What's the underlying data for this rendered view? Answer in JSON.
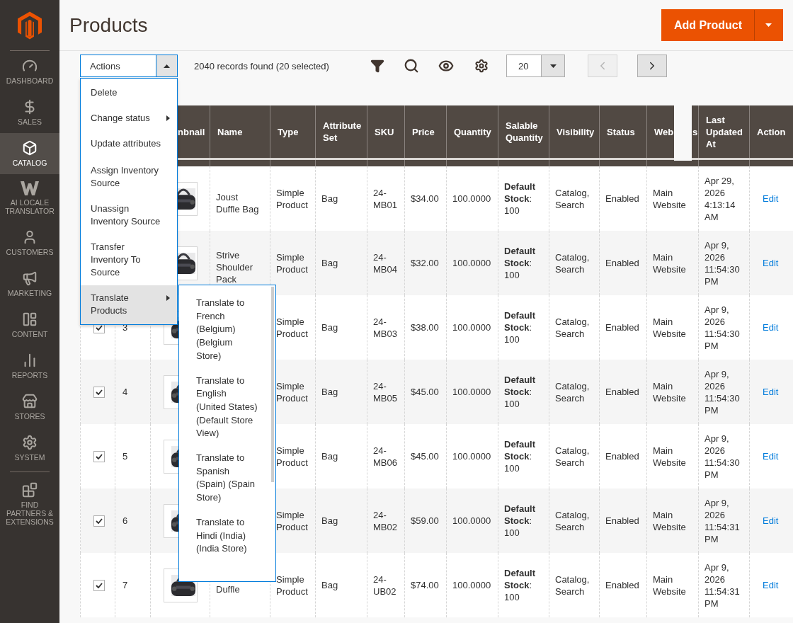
{
  "sidebar": {
    "items": [
      {
        "label": "DASHBOARD",
        "selected": false
      },
      {
        "label": "SALES",
        "selected": false
      },
      {
        "label": "CATALOG",
        "selected": true
      },
      {
        "label": "AI LOCALE TRANSLATOR",
        "selected": false
      },
      {
        "label": "CUSTOMERS",
        "selected": false
      },
      {
        "label": "MARKETING",
        "selected": false
      },
      {
        "label": "CONTENT",
        "selected": false
      },
      {
        "label": "REPORTS",
        "selected": false
      },
      {
        "label": "STORES",
        "selected": false
      },
      {
        "label": "SYSTEM",
        "selected": false
      },
      {
        "label": "FIND PARTNERS & EXTENSIONS",
        "selected": false
      }
    ]
  },
  "page": {
    "title": "Products",
    "add_button": "Add Product"
  },
  "toolbar": {
    "actions": {
      "value": "Actions",
      "expanded": true
    },
    "records": "2040 records found (20 selected)",
    "per_page": "20",
    "prev_disabled": true
  },
  "actions_menu": [
    {
      "label": "Delete",
      "submenu": false,
      "selected": false
    },
    {
      "label": "Change status",
      "submenu": true,
      "selected": false
    },
    {
      "label": "Update attributes",
      "submenu": false,
      "selected": false
    },
    {
      "label": "Assign Inventory Source",
      "submenu": false,
      "selected": false
    },
    {
      "label": "Unassign Inventory Source",
      "submenu": false,
      "selected": false
    },
    {
      "label": "Transfer Inventory To Source",
      "submenu": false,
      "selected": false
    },
    {
      "label": "Translate Products",
      "submenu": true,
      "selected": true
    }
  ],
  "submenu": [
    "Translate to French (Belgium) (Belgium Store)",
    "Translate to English (United States) (Default Store View)",
    "Translate to Spanish (Spain) (Spain Store)",
    "Translate to Hindi (India) (India Store)"
  ],
  "table": {
    "columns": [
      {
        "label": "nbnail"
      },
      {
        "label": "Name"
      },
      {
        "label": "Type"
      },
      {
        "label": "Attribute Set"
      },
      {
        "label": "SKU"
      },
      {
        "label": "Price"
      },
      {
        "label": "Quantity"
      },
      {
        "label": "Salable Quantity"
      },
      {
        "label": "Visibility"
      },
      {
        "label": "Status"
      },
      {
        "label": "Web",
        "tail": "s"
      },
      {
        "label": "Last Updated At"
      },
      {
        "label": "Action"
      }
    ],
    "rows": [
      {
        "name": "Joust Duffle Bag",
        "type": "Simple Product",
        "attribute_set": "Bag",
        "sku": "24-MB01",
        "price": "$34.00",
        "quantity": "100.0000",
        "salable": "**Default Stock**: 100",
        "visibility": "Catalog, Search",
        "status": "Enabled",
        "websites": "Main Website",
        "updated": "Apr 29, 2026 4:13:14 AM",
        "action": "Edit"
      },
      {
        "name": "Strive Shoulder Pack",
        "type": "Simple Product",
        "attribute_set": "Bag",
        "sku": "24-MB04",
        "price": "$32.00",
        "quantity": "100.0000",
        "salable": "**Default Stock**: 100",
        "visibility": "Catalog, Search",
        "status": "Enabled",
        "websites": "Main Website",
        "updated": "Apr 9, 2026 11:54:30 PM",
        "action": "Edit"
      },
      {
        "checked": true,
        "id": "3",
        "type": "Simple Product",
        "attribute_set": "Bag",
        "sku": "24-MB03",
        "price": "$38.00",
        "quantity": "100.0000",
        "salable": "**Default Stock**: 100",
        "visibility": "Catalog, Search",
        "status": "Enabled",
        "websites": "Main Website",
        "updated": "Apr 9, 2026 11:54:30 PM",
        "action": "Edit"
      },
      {
        "checked": true,
        "id": "4",
        "type": "Simple Product",
        "attribute_set": "Bag",
        "sku": "24-MB05",
        "price": "$45.00",
        "quantity": "100.0000",
        "salable": "**Default Stock**: 100",
        "visibility": "Catalog, Search",
        "status": "Enabled",
        "websites": "Main Website",
        "updated": "Apr 9, 2026 11:54:30 PM",
        "action": "Edit"
      },
      {
        "checked": true,
        "id": "5",
        "type": "Simple Product",
        "attribute_set": "Bag",
        "sku": "24-MB06",
        "price": "$45.00",
        "quantity": "100.0000",
        "salable": "**Default Stock**: 100",
        "visibility": "Catalog, Search",
        "status": "Enabled",
        "websites": "Main Website",
        "updated": "Apr 9, 2026 11:54:30 PM",
        "action": "Edit"
      },
      {
        "checked": true,
        "id": "6",
        "type": "Simple Product",
        "attribute_set": "Bag",
        "sku": "24-MB02",
        "price": "$59.00",
        "quantity": "100.0000",
        "salable": "**Default Stock**: 100",
        "visibility": "Catalog, Search",
        "status": "Enabled",
        "websites": "Main Website",
        "updated": "Apr 9, 2026 11:54:31 PM",
        "action": "Edit"
      },
      {
        "checked": true,
        "id": "7",
        "name": "Duffle",
        "type": "Simple Product",
        "attribute_set": "Bag",
        "sku": "24-UB02",
        "price": "$74.00",
        "quantity": "100.0000",
        "salable": "**Default Stock**: 100",
        "visibility": "Catalog, Search",
        "status": "Enabled",
        "websites": "Main Website",
        "updated": "Apr 9, 2026 11:54:31 PM",
        "action": "Edit"
      }
    ]
  }
}
